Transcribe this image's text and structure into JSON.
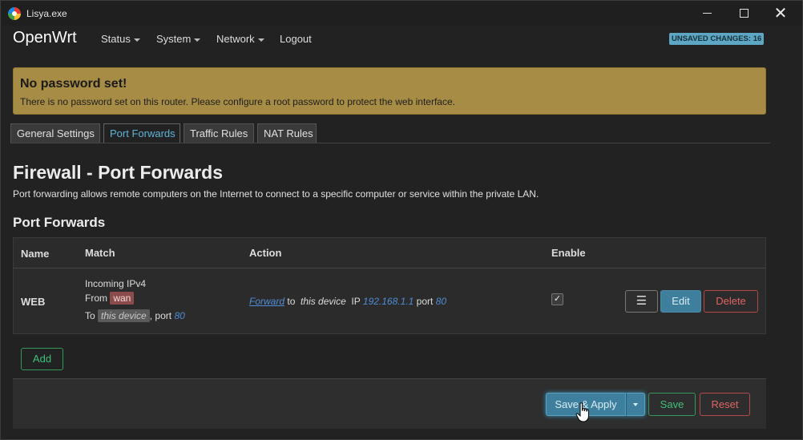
{
  "window": {
    "title": "Lisya.exe",
    "icon": "app-icon"
  },
  "navbar": {
    "brand": "OpenWrt",
    "menus": [
      "Status",
      "System",
      "Network",
      "Logout"
    ],
    "unsaved_badge": "UNSAVED CHANGES: 16"
  },
  "alert": {
    "title": "No password set!",
    "text": "There is no password set on this router. Please configure a root password to protect the web interface."
  },
  "tabs": [
    {
      "label": "General Settings",
      "active": false
    },
    {
      "label": "Port Forwards",
      "active": true
    },
    {
      "label": "Traffic Rules",
      "active": false
    },
    {
      "label": "NAT Rules",
      "active": false
    }
  ],
  "page": {
    "title": "Firewall - Port Forwards",
    "description": "Port forwarding allows remote computers on the Internet to connect to a specific computer or service within the private LAN.",
    "section_title": "Port Forwards"
  },
  "table": {
    "headers": [
      "Name",
      "Match",
      "Action",
      "Enable"
    ],
    "rows": [
      {
        "name": "WEB",
        "match_line1": "Incoming IPv4",
        "match_from_label": "From",
        "match_from_zone": "wan",
        "match_to_label": "To",
        "match_to_device": "this device",
        "match_port_label": ", port",
        "match_port": "80",
        "action_forward": "Forward",
        "action_to": "to",
        "action_device": "this device",
        "action_ip_label": "IP",
        "action_ip": "192.168.1.1",
        "action_port_label": "port",
        "action_port": "80",
        "enabled": true,
        "enabled_mark": "✓",
        "menu_icon": "☰",
        "edit_label": "Edit",
        "delete_label": "Delete"
      }
    ],
    "add_label": "Add"
  },
  "footer": {
    "save_apply_label": "Save & Apply",
    "save_label": "Save",
    "reset_label": "Reset"
  },
  "colors": {
    "accent": "#3d7f9c",
    "success": "#3fc07a",
    "danger": "#e06464",
    "warning_bg": "#a68c44"
  }
}
